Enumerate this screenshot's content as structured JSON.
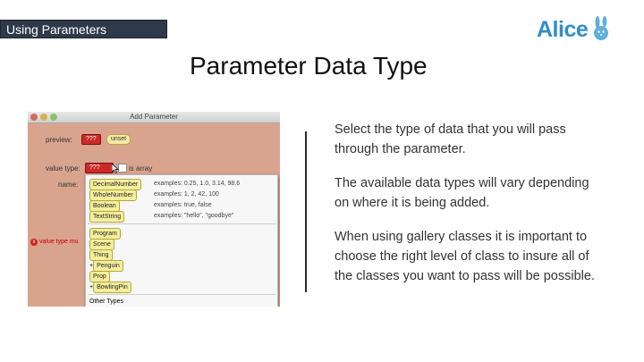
{
  "header": {
    "section_tag": "Using Parameters",
    "logo_text": "Alice"
  },
  "slide": {
    "title": "Parameter Data Type",
    "paragraphs": [
      "Select the type of data that you will pass through the parameter.",
      "The available data types will vary depending on where it is being added.",
      "When using gallery classes it is important to choose the right level of class to insure all of the classes you want to pass will be possible."
    ]
  },
  "dialog": {
    "title": "Add Parameter",
    "preview_label": "preview:",
    "preview_pill_a": "???",
    "preview_pill_b": "unset",
    "value_type_label": "value type:",
    "value_type_value": "???",
    "is_array_label": "is array",
    "name_label": "name:",
    "error_text": "value type mu",
    "menu": {
      "items": [
        {
          "type": "DecimalNumber",
          "example": "examples: 0.25, 1.0, 3.14, 98.6"
        },
        {
          "type": "WholeNumber",
          "example": "examples: 1, 2, 42, 100"
        },
        {
          "type": "Boolean",
          "example": "examples: true, false"
        },
        {
          "type": "TextString",
          "example": "examples: \"hello\", \"goodbye\""
        }
      ],
      "classes": [
        {
          "prefix": "",
          "type": "Program"
        },
        {
          "prefix": "",
          "type": "Scene"
        },
        {
          "prefix": "",
          "type": "Thing"
        },
        {
          "prefix": "+",
          "type": "Penguin"
        },
        {
          "prefix": "",
          "type": "Prop"
        },
        {
          "prefix": "+",
          "type": "BowlingPin"
        }
      ],
      "other_types": "Other Types"
    }
  },
  "colors": {
    "tag_bg": "#2e3a4a",
    "logo": "#2f8ec9",
    "dialog_bg": "#d9a48e",
    "pill_red": "#cc2a2a",
    "pill_yellow": "#f4ef9c"
  },
  "icons": {
    "logo_mark": "bunny-icon",
    "error": "error-icon",
    "close": "close-icon"
  }
}
